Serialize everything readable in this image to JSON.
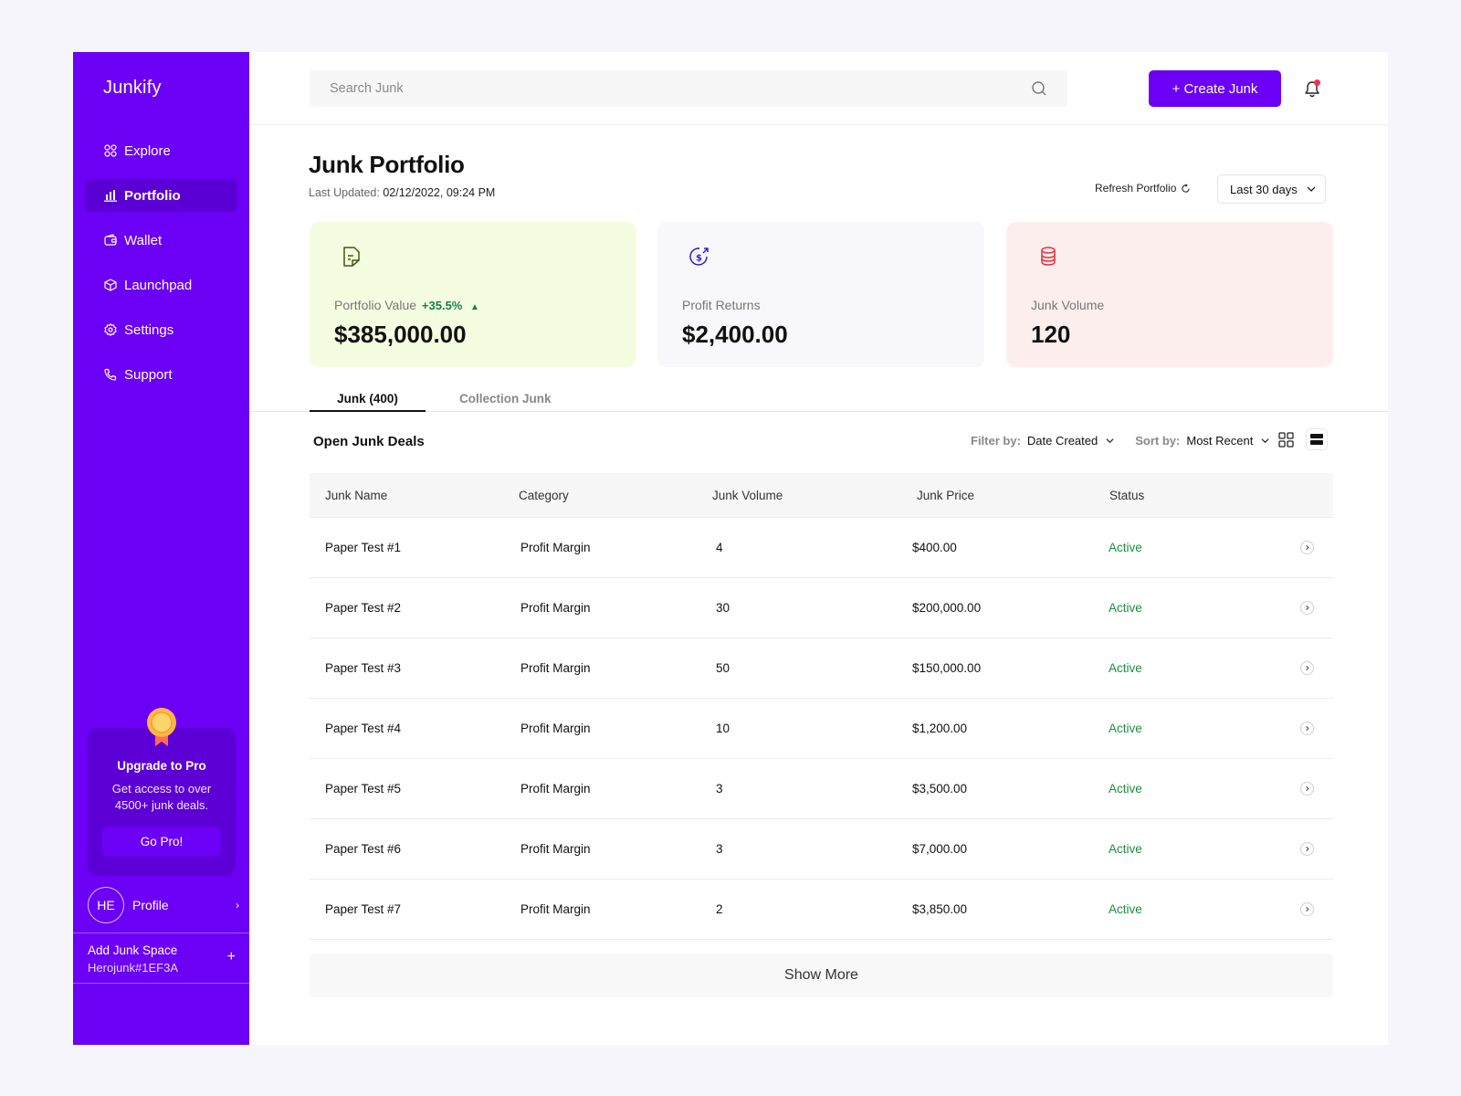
{
  "app": {
    "brand": "Junkify"
  },
  "sidebar": {
    "items": [
      {
        "label": "Explore",
        "icon": "grid-icon"
      },
      {
        "label": "Portfolio",
        "icon": "bar-chart-icon",
        "active": true
      },
      {
        "label": "Wallet",
        "icon": "wallet-icon"
      },
      {
        "label": "Launchpad",
        "icon": "cube-icon"
      },
      {
        "label": "Settings",
        "icon": "gear-icon"
      },
      {
        "label": "Support",
        "icon": "phone-icon"
      }
    ],
    "promo": {
      "title": "Upgrade to Pro",
      "text": "Get access to over 4500+ junk deals.",
      "button": "Go Pro!"
    },
    "profile": {
      "initials": "HE",
      "label": "Profile"
    },
    "space": {
      "title": "Add Junk Space",
      "id": "Herojunk#1EF3A"
    }
  },
  "header": {
    "search_placeholder": "Search Junk",
    "create_label": "+ Create Junk"
  },
  "page": {
    "title": "Junk Portfolio",
    "updated_label": "Last Updated:",
    "updated_value": "02/12/2022, 09:24 PM",
    "refresh_label": "Refresh Portfolio",
    "range_label": "Last 30 days"
  },
  "cards": [
    {
      "label": "Portfolio Value",
      "delta": "+35.5%",
      "value": "$385,000.00",
      "icon": "document-icon"
    },
    {
      "label": "Profit Returns",
      "value": "$2,400.00",
      "icon": "dollar-return-icon"
    },
    {
      "label": "Junk Volume",
      "value": "120",
      "icon": "coin-stack-icon"
    }
  ],
  "tabs": {
    "active": "Junk (400)",
    "inactive": "Collection Junk"
  },
  "deals": {
    "title": "Open Junk Deals",
    "filter_label": "Filter by:",
    "filter_value": "Date Created",
    "sort_label": "Sort by:",
    "sort_value": "Most Recent",
    "columns": [
      "Junk Name",
      "Category",
      "Junk Volume",
      "Junk Price",
      "Status"
    ],
    "rows": [
      {
        "name": "Paper Test #1",
        "category": "Profit Margin",
        "volume": "4",
        "price": "$400.00",
        "status": "Active"
      },
      {
        "name": "Paper Test #2",
        "category": "Profit Margin",
        "volume": "30",
        "price": "$200,000.00",
        "status": "Active"
      },
      {
        "name": "Paper Test #3",
        "category": "Profit Margin",
        "volume": "50",
        "price": "$150,000.00",
        "status": "Active"
      },
      {
        "name": "Paper Test #4",
        "category": "Profit Margin",
        "volume": "10",
        "price": "$1,200.00",
        "status": "Active"
      },
      {
        "name": "Paper Test #5",
        "category": "Profit Margin",
        "volume": "3",
        "price": "$3,500.00",
        "status": "Active"
      },
      {
        "name": "Paper Test #6",
        "category": "Profit Margin",
        "volume": "3",
        "price": "$7,000.00",
        "status": "Active"
      },
      {
        "name": "Paper Test #7",
        "category": "Profit Margin",
        "volume": "2",
        "price": "$3,850.00",
        "status": "Active"
      }
    ],
    "show_more": "Show More"
  },
  "colors": {
    "accent": "#6b00f5",
    "sidebar_active": "#5b00d4",
    "status_active": "#1a8f3c",
    "delta_up": "#157f4a",
    "card_green": "#f5fde1",
    "card_lavender": "#f7f7fc",
    "card_pink": "#fdeeee"
  }
}
